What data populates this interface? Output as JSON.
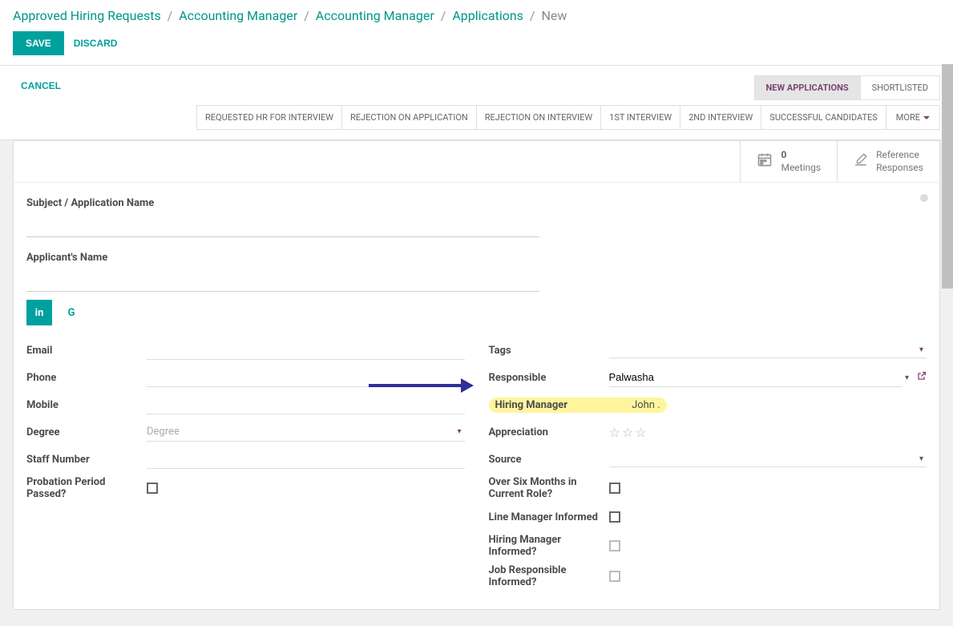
{
  "breadcrumb": {
    "items": [
      "Approved Hiring Requests",
      "Accounting Manager",
      "Accounting Manager",
      "Applications"
    ],
    "current": "New"
  },
  "toolbar": {
    "save": "SAVE",
    "discard": "DISCARD"
  },
  "cancel": "CANCEL",
  "stages_top": [
    "NEW APPLICATIONS",
    "SHORTLISTED"
  ],
  "stages_bottom": [
    "REQUESTED HR FOR INTERVIEW",
    "REJECTION ON APPLICATION",
    "REJECTION ON INTERVIEW",
    "1ST INTERVIEW",
    "2ND INTERVIEW",
    "SUCCESSFUL CANDIDATES"
  ],
  "more": "MORE",
  "stats": {
    "meetings_count": "0",
    "meetings_label": "Meetings",
    "reference_l1": "Reference",
    "reference_l2": "Responses"
  },
  "subject_label": "Subject / Application Name",
  "applicant_label": "Applicant's Name",
  "social": {
    "in": "in",
    "g": "G"
  },
  "left": {
    "email": "Email",
    "phone": "Phone",
    "mobile": "Mobile",
    "degree": "Degree",
    "degree_placeholder": "Degree",
    "staff": "Staff Number",
    "probation": "Probation Period Passed?"
  },
  "right": {
    "tags": "Tags",
    "responsible": "Responsible",
    "responsible_value": "Palwasha",
    "hiring_manager": "Hiring Manager",
    "hiring_manager_value": "John .",
    "appreciation": "Appreciation",
    "source": "Source",
    "over6": "Over Six Months in Current Role?",
    "linemgr": "Line Manager Informed",
    "hmgr": "Hiring Manager Informed?",
    "jobresp": "Job Responsible Informed?"
  }
}
